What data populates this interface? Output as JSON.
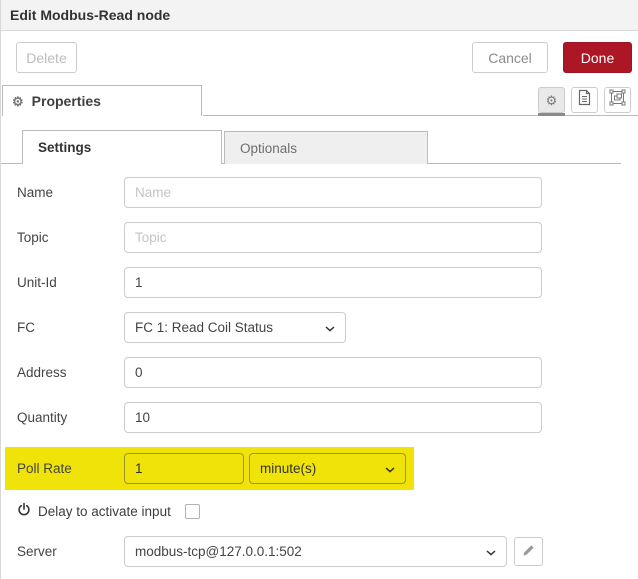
{
  "window": {
    "title": "Edit Modbus-Read node"
  },
  "actions": {
    "delete_label": "Delete",
    "cancel_label": "Cancel",
    "done_label": "Done"
  },
  "editor_tab": {
    "label": "Properties"
  },
  "sub_tabs": {
    "settings_label": "Settings",
    "optionals_label": "Optionals"
  },
  "icons": {
    "gear_glyph": "⚙"
  },
  "form": {
    "name": {
      "label": "Name",
      "placeholder": "Name",
      "value": ""
    },
    "topic": {
      "label": "Topic",
      "placeholder": "Topic",
      "value": ""
    },
    "unit_id": {
      "label": "Unit-Id",
      "value": "1"
    },
    "fc": {
      "label": "FC",
      "selected": "FC 1: Read Coil Status"
    },
    "address": {
      "label": "Address",
      "value": "0"
    },
    "quantity": {
      "label": "Quantity",
      "value": "10"
    },
    "poll_rate": {
      "label": "Poll Rate",
      "value": "1",
      "unit_selected": "minute(s)",
      "highlighted": true
    },
    "delay": {
      "label": "Delay to activate input",
      "checked": false
    },
    "server": {
      "label": "Server",
      "selected": "modbus-tcp@127.0.0.1:502"
    }
  },
  "colors": {
    "done_button": "#ad1625",
    "highlight": "#f0e309",
    "tab_border": "#bbbbbb",
    "titlebar_bg": "#f3f3f3"
  }
}
